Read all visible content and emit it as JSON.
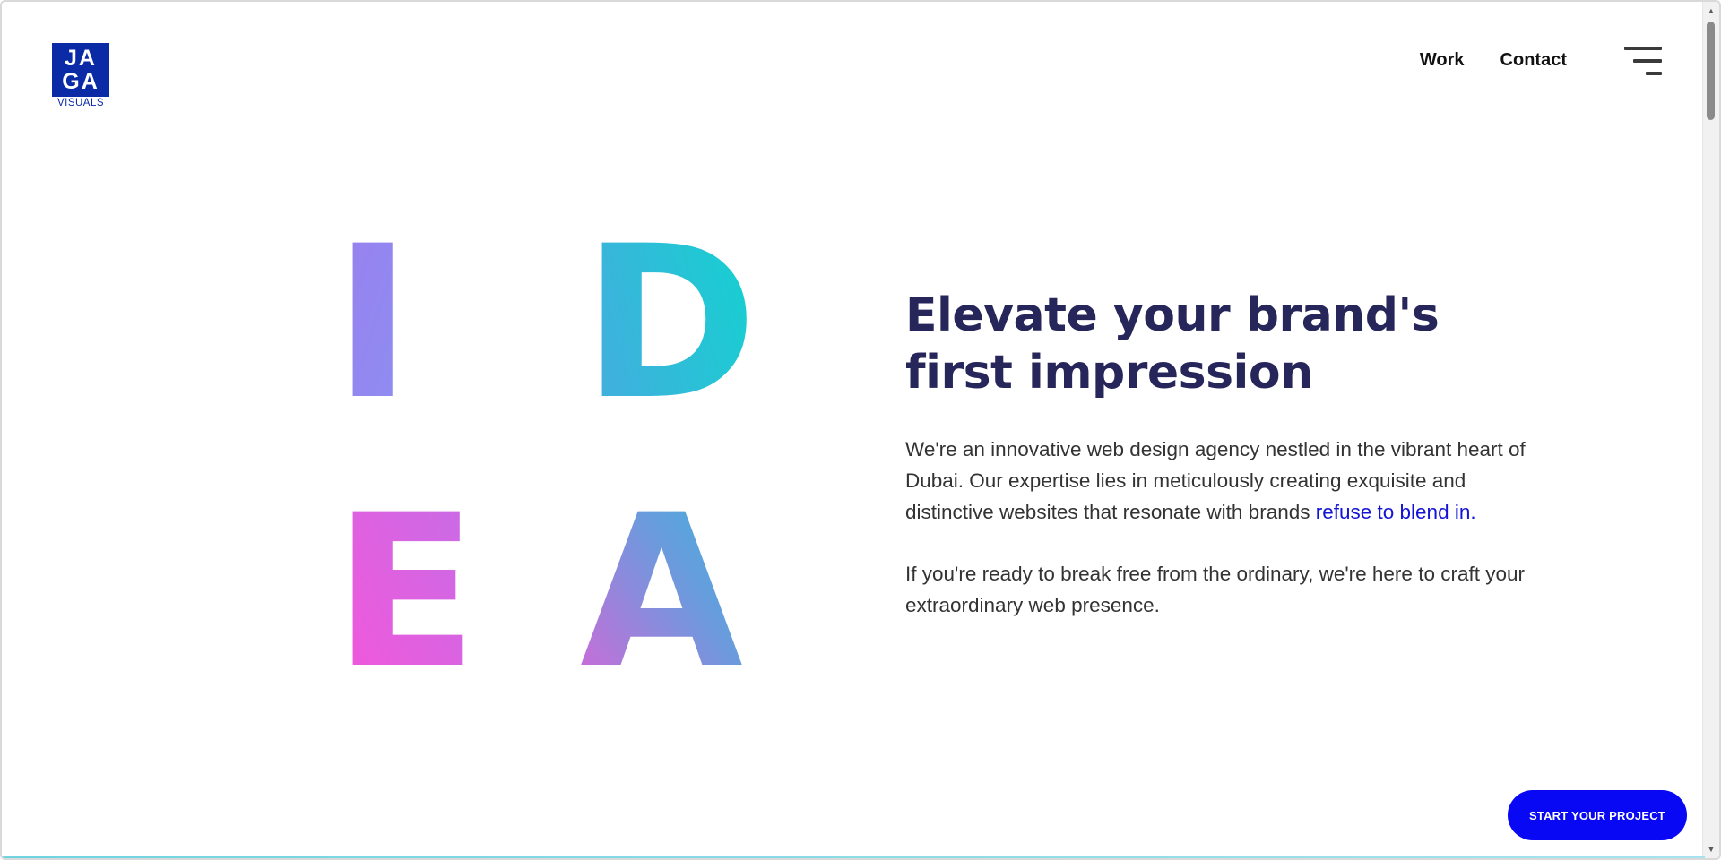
{
  "brand": {
    "logo_line1": "JA",
    "logo_line2": "GA",
    "logo_sub": "VISUALS",
    "primary_color": "#0a2aa6"
  },
  "nav": {
    "items": [
      {
        "label": "Work"
      },
      {
        "label": "Contact"
      }
    ],
    "menu_icon": "hamburger-menu-icon"
  },
  "hero_letters": {
    "letters": [
      "I",
      "D",
      "E",
      "A"
    ],
    "gradient_colors": [
      "#9b7ff0",
      "#18d3cf",
      "#f353dc",
      "#7e95e0"
    ]
  },
  "hero": {
    "title": "Elevate your brand's first impression",
    "para1_text": "We're an innovative web design agency nestled in the vibrant heart of Dubai. Our expertise lies in meticulously creating exquisite and distinctive websites that resonate with brands ",
    "para1_link": "refuse to blend in.",
    "para2": "If you're ready to break free from the ordinary, we're here to craft your extraordinary web presence.",
    "heading_color": "#26265a",
    "link_color": "#1414d6"
  },
  "cta": {
    "label": "START YOUR PROJECT",
    "color": "#0808f4"
  }
}
